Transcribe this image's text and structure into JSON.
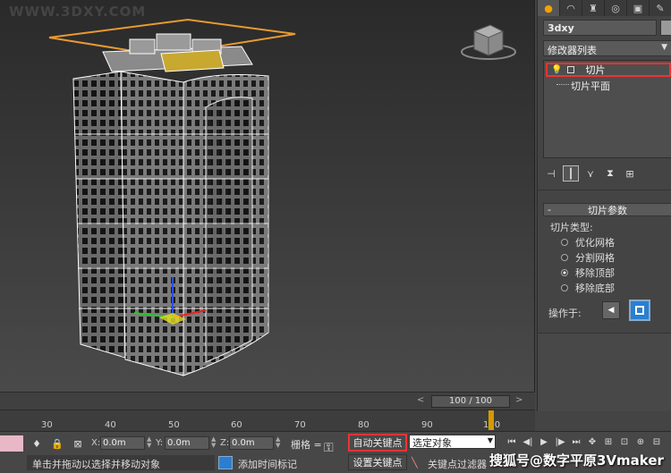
{
  "watermark_top": "WWW.3DXY.COM",
  "command_panel": {
    "tabs": [
      {
        "icon": "sun-icon",
        "glyph": "●"
      },
      {
        "icon": "bend-icon",
        "glyph": "◠"
      },
      {
        "icon": "hierarchy-icon",
        "glyph": "♜"
      },
      {
        "icon": "motion-icon",
        "glyph": "◎"
      },
      {
        "icon": "display-icon",
        "glyph": "▣"
      },
      {
        "icon": "utilities-icon",
        "glyph": "✎"
      }
    ],
    "object_name": "3dxy",
    "object_color": "#9a9a9a",
    "modifier_list": "修改器列表",
    "stack": {
      "modifier": "切片",
      "sub_object": "切片平面"
    },
    "rollout_title": "切片参数",
    "slice_type_label": "切片类型:",
    "options": [
      {
        "label": "优化网格",
        "selected": false
      },
      {
        "label": "分割网格",
        "selected": false
      },
      {
        "label": "移除顶部",
        "selected": true
      },
      {
        "label": "移除底部",
        "selected": false
      }
    ],
    "operate_on_label": "操作于:"
  },
  "time_slider": {
    "position": "100 / 100",
    "left_arrow": "<",
    "right_arrow": ">"
  },
  "track_bar": {
    "ticks": [
      "30",
      "40",
      "50",
      "60",
      "70",
      "80",
      "90",
      "100"
    ]
  },
  "status_bar": {
    "x_label": "X:",
    "x_value": "0.0m",
    "y_label": "Y:",
    "y_value": "0.0m",
    "z_label": "Z:",
    "z_value": "0.0m",
    "grid_label": "栅格 =",
    "auto_key": "自动关键点",
    "selection": "选定对象",
    "set_key": "设置关键点",
    "key_filters": "关键点过滤器",
    "prompt": "单击并拖动以选择并移动对象",
    "add_time_tag": "添加时间标记"
  },
  "watermark": "搜狐号@数字平原3Vmaker"
}
